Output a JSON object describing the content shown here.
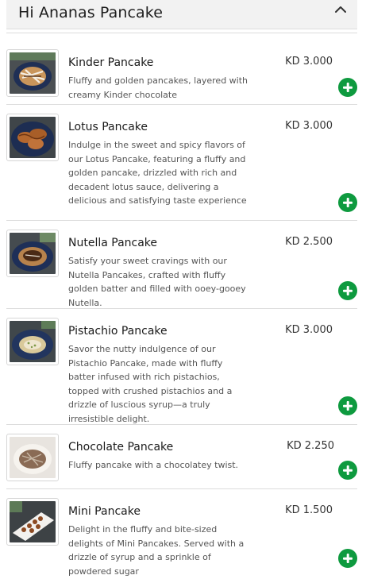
{
  "section": {
    "title": "Hi Ananas Pancake",
    "toggle_icon": "chevron-up-icon"
  },
  "items": [
    {
      "name": "Kinder Pancake",
      "description": "Fluffy and golden pancakes, layered with creamy Kinder chocolate",
      "price": "KD 3.000",
      "add_icon": "plus-icon"
    },
    {
      "name": "Lotus Pancake",
      "description": "Indulge in the sweet and spicy flavors of our Lotus Pancake, featuring a fluffy and golden pancake, drizzled with rich and decadent lotus sauce, delivering a delicious and satisfying taste experience",
      "price": "KD 3.000",
      "add_icon": "plus-icon"
    },
    {
      "name": "Nutella Pancake",
      "description": "Satisfy your sweet cravings with our Nutella Pancakes, crafted with fluffy golden batter and filled with ooey-gooey Nutella.",
      "price": "KD 2.500",
      "add_icon": "plus-icon"
    },
    {
      "name": "Pistachio Pancake",
      "description": "Savor the nutty indulgence of our Pistachio Pancake, made with fluffy batter infused with rich pistachios, topped with crushed pistachios and a drizzle of luscious syrup—a truly irresistible delight.",
      "price": "KD 3.000",
      "add_icon": "plus-icon"
    },
    {
      "name": "Chocolate Pancake",
      "description": "Fluffy pancake with a chocolatey twist.",
      "price": "KD 2.250",
      "add_icon": "plus-icon"
    },
    {
      "name": "Mini Pancake",
      "description": "Delight in the fluffy and bite-sized delights of Mini Pancakes. Served with a drizzle of syrup and a sprinkle of powdered sugar",
      "price": "KD 1.500",
      "add_icon": "plus-icon"
    }
  ],
  "colors": {
    "accent_green": "#0e9a3f",
    "header_bg": "#f2f2f2"
  }
}
